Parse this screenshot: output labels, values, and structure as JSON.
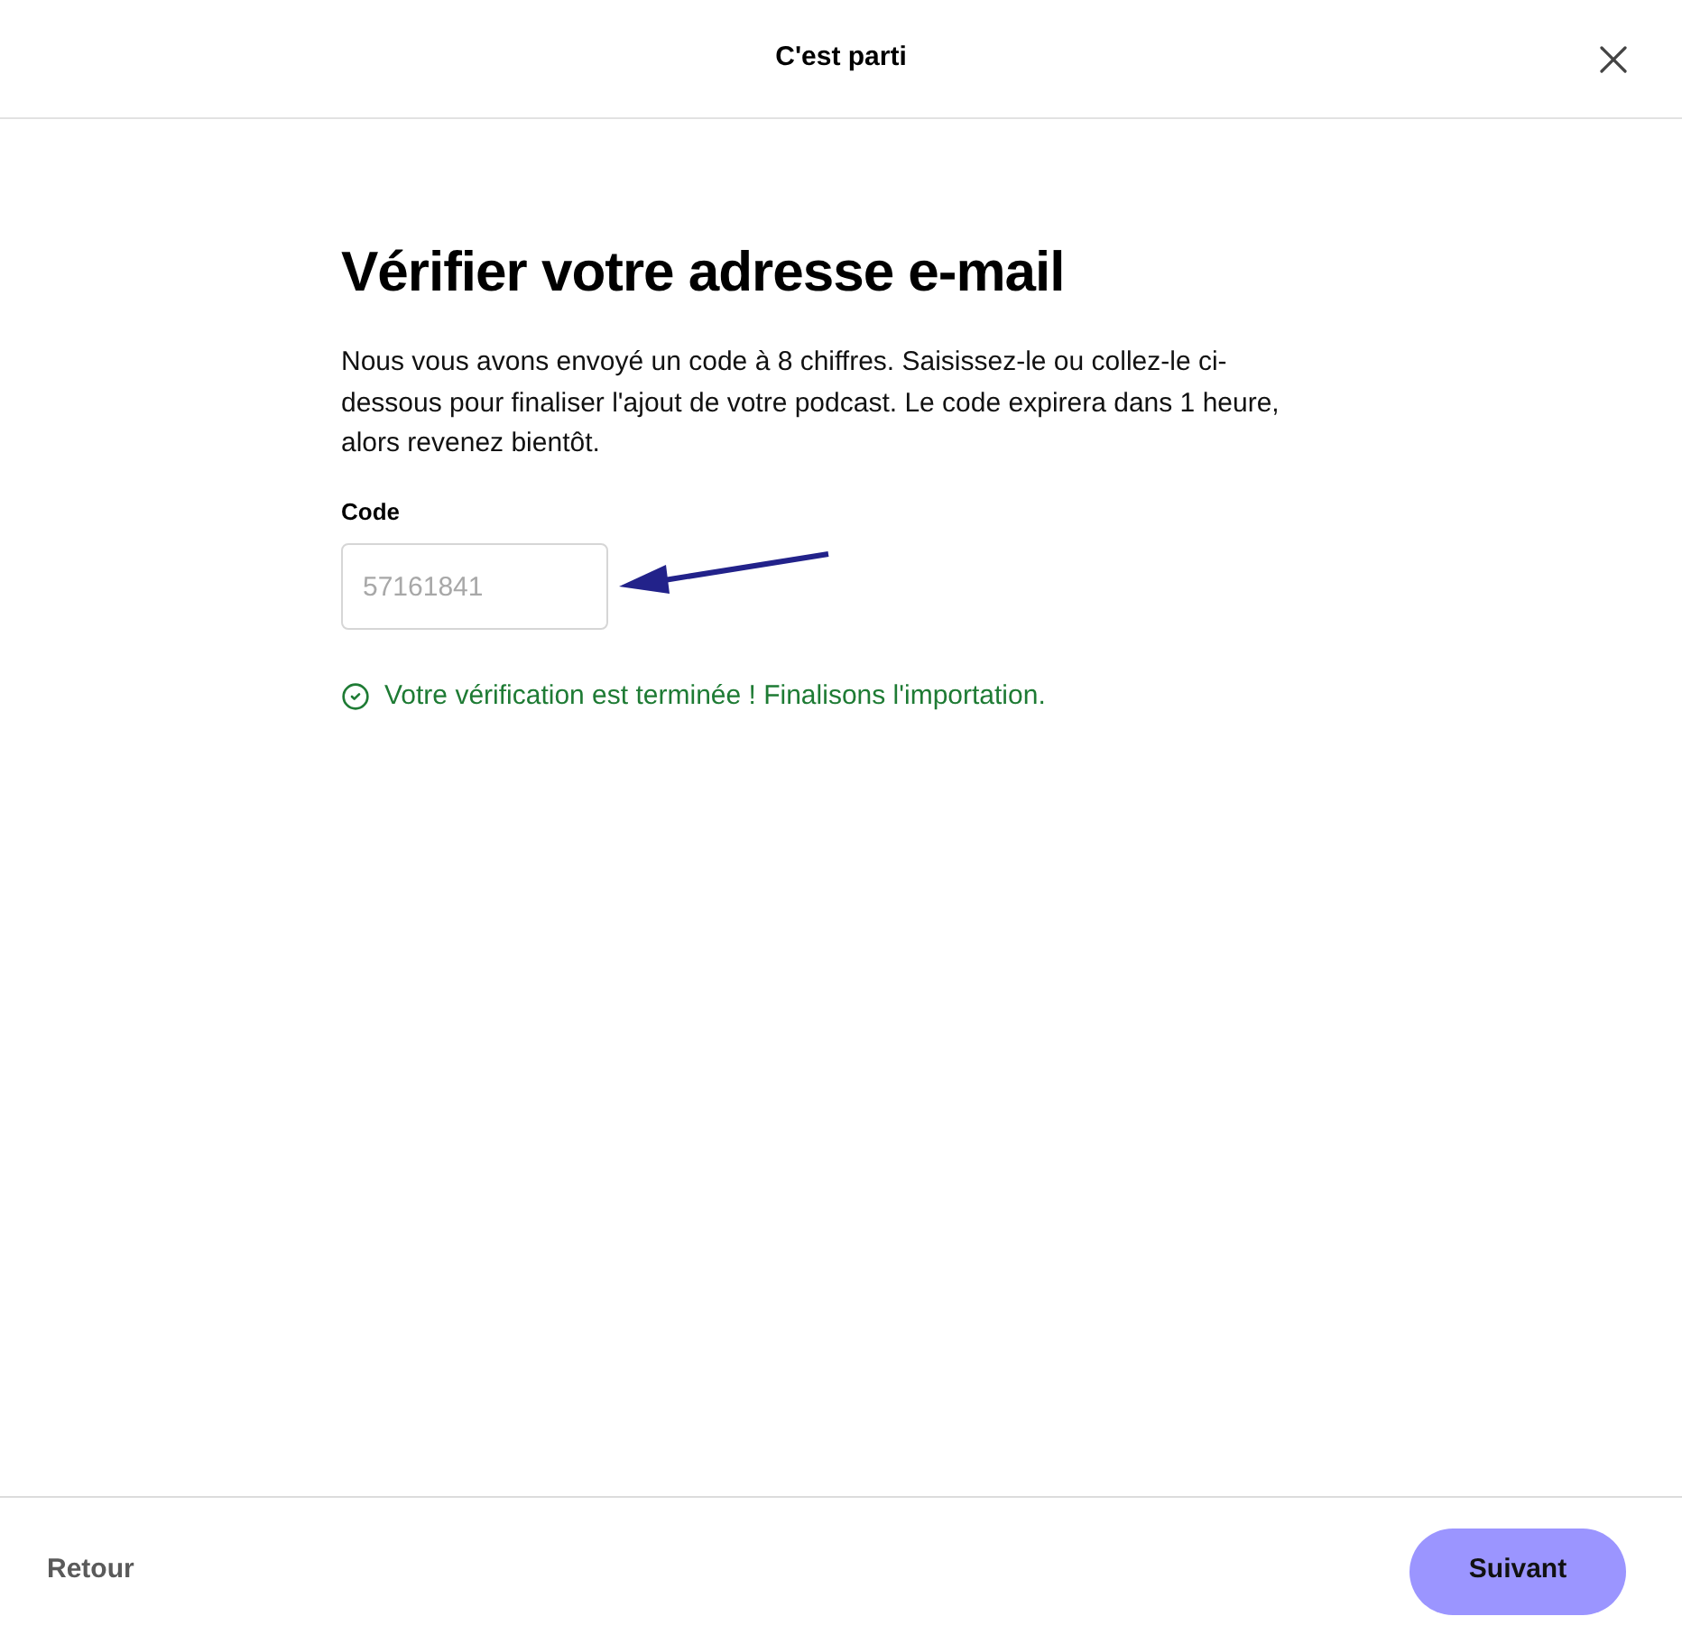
{
  "header": {
    "title": "C'est parti"
  },
  "heading": "Vérifier votre adresse e-mail",
  "description": "Nous vous avons envoyé un code à 8 chiffres. Saisissez-le ou collez-le ci-dessous pour finaliser l'ajout de votre podcast. Le code expirera dans 1 heure, alors revenez bientôt.",
  "code_field": {
    "label": "Code",
    "placeholder": "57161841"
  },
  "status": {
    "kind": "success",
    "text": "Votre vérification est terminée ! Finalisons l'importation."
  },
  "footer": {
    "back": "Retour",
    "next": "Suivant"
  }
}
